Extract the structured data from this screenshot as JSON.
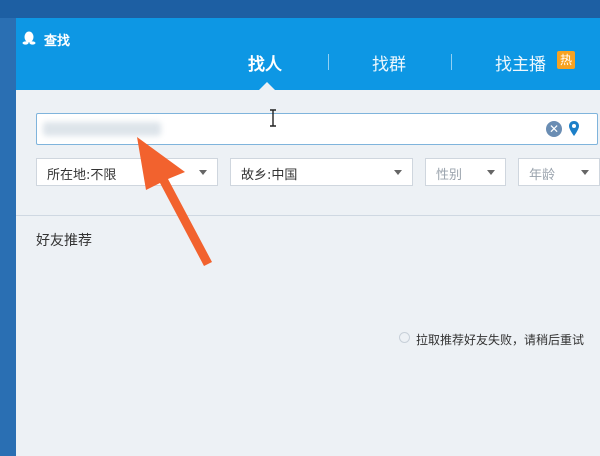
{
  "window": {
    "title": "查找",
    "icon": "penguin-icon"
  },
  "tabs": [
    {
      "label": "找人",
      "active": true
    },
    {
      "label": "找群",
      "active": false
    },
    {
      "label": "找主播",
      "active": false,
      "badge": "热"
    }
  ],
  "search": {
    "value": "",
    "clear_icon": "close-circle-icon",
    "location_icon": "location-pin-icon"
  },
  "filters": {
    "location": "所在地:不限",
    "hometown": "故乡:中国",
    "gender": "性别",
    "age": "年龄"
  },
  "recommend": {
    "title": "好友推荐",
    "status": "拉取推荐好友失败，请稍后重试"
  },
  "colors": {
    "header": "#0d97e4",
    "badge": "#f7a221",
    "annotation_arrow": "#f2622e"
  }
}
